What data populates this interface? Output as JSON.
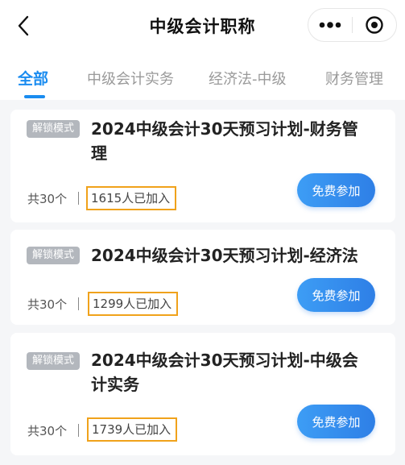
{
  "header": {
    "title": "中级会计职称"
  },
  "tabs": [
    {
      "label": "全部",
      "active": true
    },
    {
      "label": "中级会计实务",
      "active": false
    },
    {
      "label": "经济法-中级",
      "active": false
    },
    {
      "label": "财务管理",
      "active": false
    }
  ],
  "courses": [
    {
      "badge": "解锁模式",
      "title_line1": "2024中级会计30天预习计划-财务管",
      "title_line2": "理",
      "count": "共30个",
      "joined": "1615人已加入",
      "button": "免费参加"
    },
    {
      "badge": "解锁模式",
      "title_line1": "2024中级会计30天预习计划-经济法",
      "title_line2": "",
      "count": "共30个",
      "joined": "1299人已加入",
      "button": "免费参加"
    },
    {
      "badge": "解锁模式",
      "title_line1": "2024中级会计30天预习计划-中级会",
      "title_line2": "计实务",
      "count": "共30个",
      "joined": "1739人已加入",
      "button": "免费参加"
    }
  ],
  "colors": {
    "accent": "#1a8cf0",
    "highlight_box": "#f0a21b",
    "badge_bg": "#b3b7bd"
  }
}
